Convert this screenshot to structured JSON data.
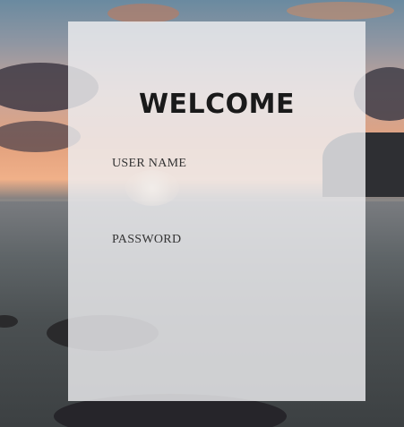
{
  "login": {
    "title": "WELCOME",
    "username_label": "USER NAME",
    "username_value": "",
    "password_label": "PASSWORD",
    "password_value": ""
  },
  "colors": {
    "panel_background": "#eeeef0",
    "title_text": "#1a1a1a",
    "label_text": "#333333"
  }
}
